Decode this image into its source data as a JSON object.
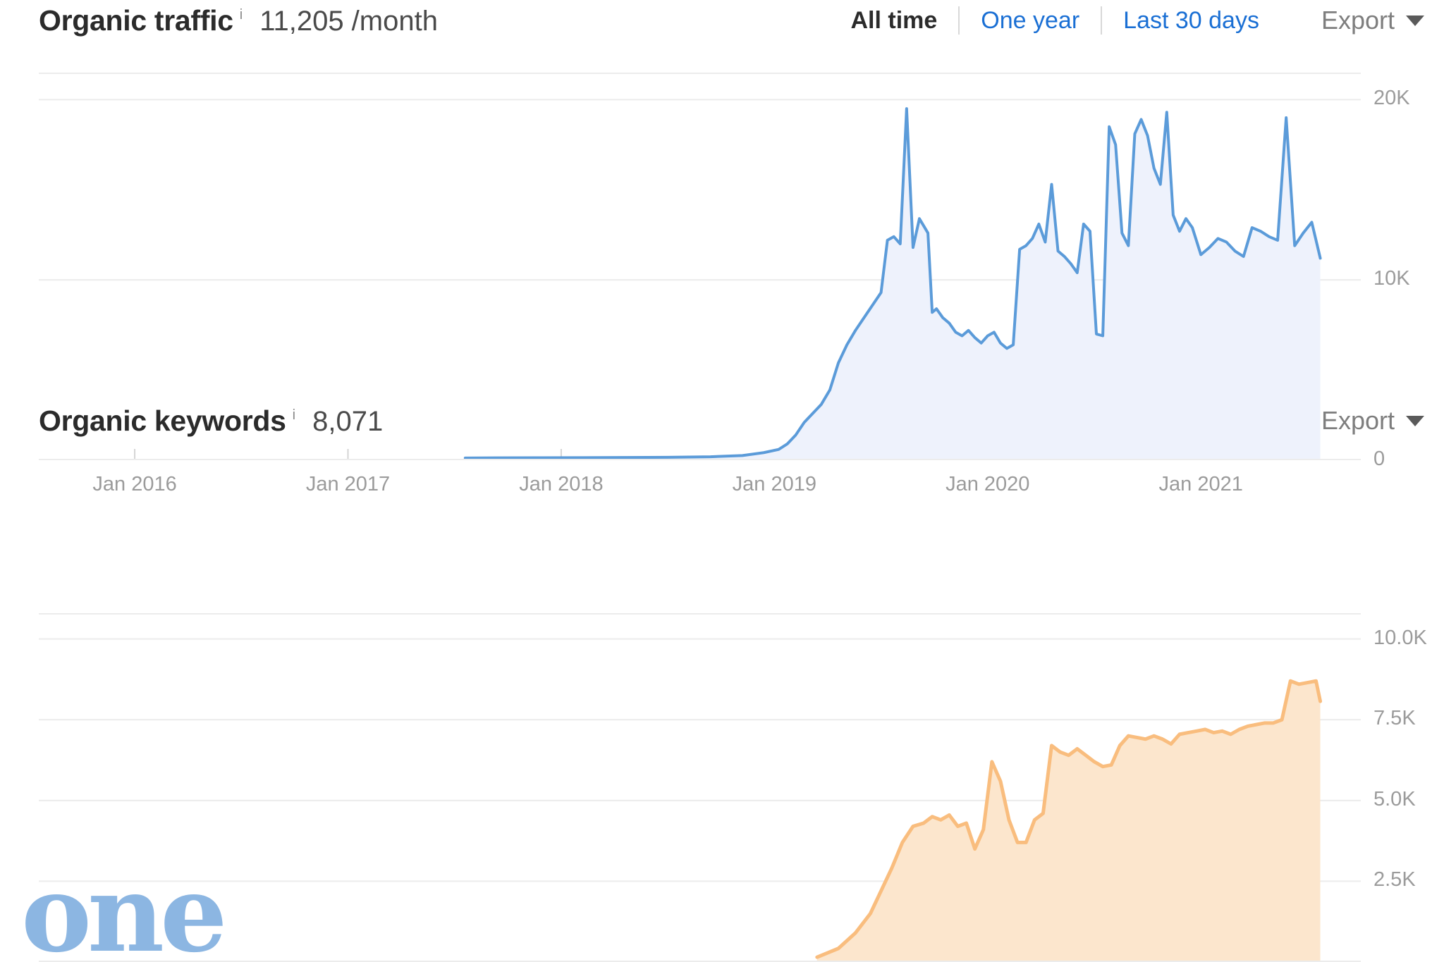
{
  "traffic_section": {
    "title": "Organic traffic",
    "info_icon": "info-icon",
    "value": "11,205 /month",
    "ranges": [
      {
        "label": "All time",
        "active": true
      },
      {
        "label": "One year",
        "active": false
      },
      {
        "label": "Last 30 days",
        "active": false
      }
    ],
    "export_label": "Export"
  },
  "keywords_section": {
    "title": "Organic keywords",
    "info_icon": "info-icon",
    "value": "8,071",
    "export_label": "Export"
  },
  "watermark": {
    "text": "one",
    "color": "#8cb6e2"
  },
  "colors": {
    "line_blue": "#5b9bd9",
    "fill_blue": "#eef2fc",
    "line_orange": "#f9bd7e",
    "fill_orange": "#fce6cd",
    "grid": "#ececec",
    "link_blue": "#1a6fd4",
    "axis_text": "#9b9b9b"
  },
  "chart_data": [
    {
      "type": "area",
      "id": "organic-traffic",
      "title": "Organic traffic",
      "xlabel": "",
      "ylabel": "",
      "ylim": [
        0,
        21500
      ],
      "yticks": [
        0,
        10000,
        20000
      ],
      "ytick_labels": [
        "0",
        "10K",
        "20K"
      ],
      "grid": true,
      "legend": "none",
      "xtick_labels": [
        "Jan 2016",
        "Jan 2017",
        "Jan 2018",
        "Jan 2019",
        "Jan 2020",
        "Jan 2021"
      ],
      "xticks": [
        2016.0,
        2017.0,
        2018.0,
        2019.0,
        2020.0,
        2021.0
      ],
      "xlim": [
        2015.55,
        2021.75
      ],
      "units": "visits / month",
      "series_name": "Organic traffic",
      "x": [
        2017.55,
        2017.7,
        2017.9,
        2018.1,
        2018.3,
        2018.5,
        2018.7,
        2018.85,
        2018.95,
        2019.02,
        2019.06,
        2019.1,
        2019.14,
        2019.18,
        2019.22,
        2019.26,
        2019.3,
        2019.34,
        2019.38,
        2019.42,
        2019.46,
        2019.5,
        2019.53,
        2019.56,
        2019.59,
        2019.62,
        2019.65,
        2019.68,
        2019.7,
        2019.72,
        2019.74,
        2019.76,
        2019.79,
        2019.82,
        2019.85,
        2019.88,
        2019.91,
        2019.94,
        2019.97,
        2020.0,
        2020.03,
        2020.06,
        2020.09,
        2020.12,
        2020.15,
        2020.18,
        2020.21,
        2020.24,
        2020.27,
        2020.3,
        2020.33,
        2020.36,
        2020.39,
        2020.42,
        2020.45,
        2020.48,
        2020.51,
        2020.54,
        2020.57,
        2020.6,
        2020.63,
        2020.66,
        2020.69,
        2020.72,
        2020.75,
        2020.78,
        2020.81,
        2020.84,
        2020.87,
        2020.9,
        2020.93,
        2020.96,
        2021.0,
        2021.04,
        2021.08,
        2021.12,
        2021.16,
        2021.2,
        2021.24,
        2021.28,
        2021.32,
        2021.36,
        2021.4,
        2021.44,
        2021.48,
        2021.52,
        2021.56
      ],
      "values": [
        120,
        130,
        135,
        140,
        150,
        160,
        190,
        260,
        420,
        600,
        900,
        1400,
        2100,
        2600,
        3100,
        3900,
        5400,
        6400,
        7200,
        7900,
        8600,
        9300,
        12200,
        12400,
        12000,
        19500,
        11800,
        13400,
        13000,
        12600,
        8200,
        8400,
        7900,
        7600,
        7100,
        6900,
        7200,
        6800,
        6500,
        6900,
        7100,
        6500,
        6200,
        6400,
        11700,
        11900,
        12300,
        13100,
        12100,
        15300,
        11600,
        11300,
        10900,
        10400,
        13100,
        12700,
        7000,
        6900,
        18500,
        17500,
        12600,
        11900,
        18100,
        18900,
        18000,
        16200,
        15300,
        19300,
        13600,
        12700,
        13400,
        12900,
        11400,
        11800,
        12300,
        12100,
        11600,
        11300,
        12900,
        12700,
        12400,
        12200,
        19000,
        11900,
        12600,
        13200,
        11205
      ]
    },
    {
      "type": "area",
      "id": "organic-keywords",
      "title": "Organic keywords",
      "xlabel": "",
      "ylabel": "",
      "ylim": [
        0,
        10800
      ],
      "yticks": [
        2500,
        5000,
        7500,
        10000
      ],
      "ytick_labels": [
        "2.5K",
        "5.0K",
        "7.5K",
        "10.0K"
      ],
      "grid": true,
      "legend": "none",
      "xlim": [
        2015.55,
        2021.75
      ],
      "units": "keywords",
      "series_name": "Organic keywords",
      "x": [
        2019.2,
        2019.3,
        2019.38,
        2019.45,
        2019.5,
        2019.55,
        2019.6,
        2019.65,
        2019.7,
        2019.74,
        2019.78,
        2019.82,
        2019.86,
        2019.9,
        2019.94,
        2019.98,
        2020.02,
        2020.06,
        2020.1,
        2020.14,
        2020.18,
        2020.22,
        2020.26,
        2020.3,
        2020.34,
        2020.38,
        2020.42,
        2020.46,
        2020.5,
        2020.54,
        2020.58,
        2020.62,
        2020.66,
        2020.7,
        2020.74,
        2020.78,
        2020.82,
        2020.86,
        2020.9,
        2020.94,
        2020.98,
        2021.02,
        2021.06,
        2021.1,
        2021.14,
        2021.18,
        2021.22,
        2021.26,
        2021.3,
        2021.34,
        2021.38,
        2021.42,
        2021.46,
        2021.5,
        2021.54,
        2021.56
      ],
      "values": [
        150,
        420,
        900,
        1500,
        2200,
        2900,
        3700,
        4200,
        4300,
        4500,
        4400,
        4550,
        4200,
        4300,
        3500,
        4100,
        6200,
        5600,
        4400,
        3700,
        3700,
        4400,
        4600,
        6700,
        6500,
        6400,
        6600,
        6400,
        6200,
        6050,
        6100,
        6700,
        7000,
        6950,
        6900,
        7000,
        6900,
        6750,
        7050,
        7100,
        7150,
        7200,
        7100,
        7150,
        7050,
        7200,
        7300,
        7350,
        7400,
        7400,
        7500,
        8700,
        8600,
        8650,
        8700,
        8071
      ]
    }
  ]
}
